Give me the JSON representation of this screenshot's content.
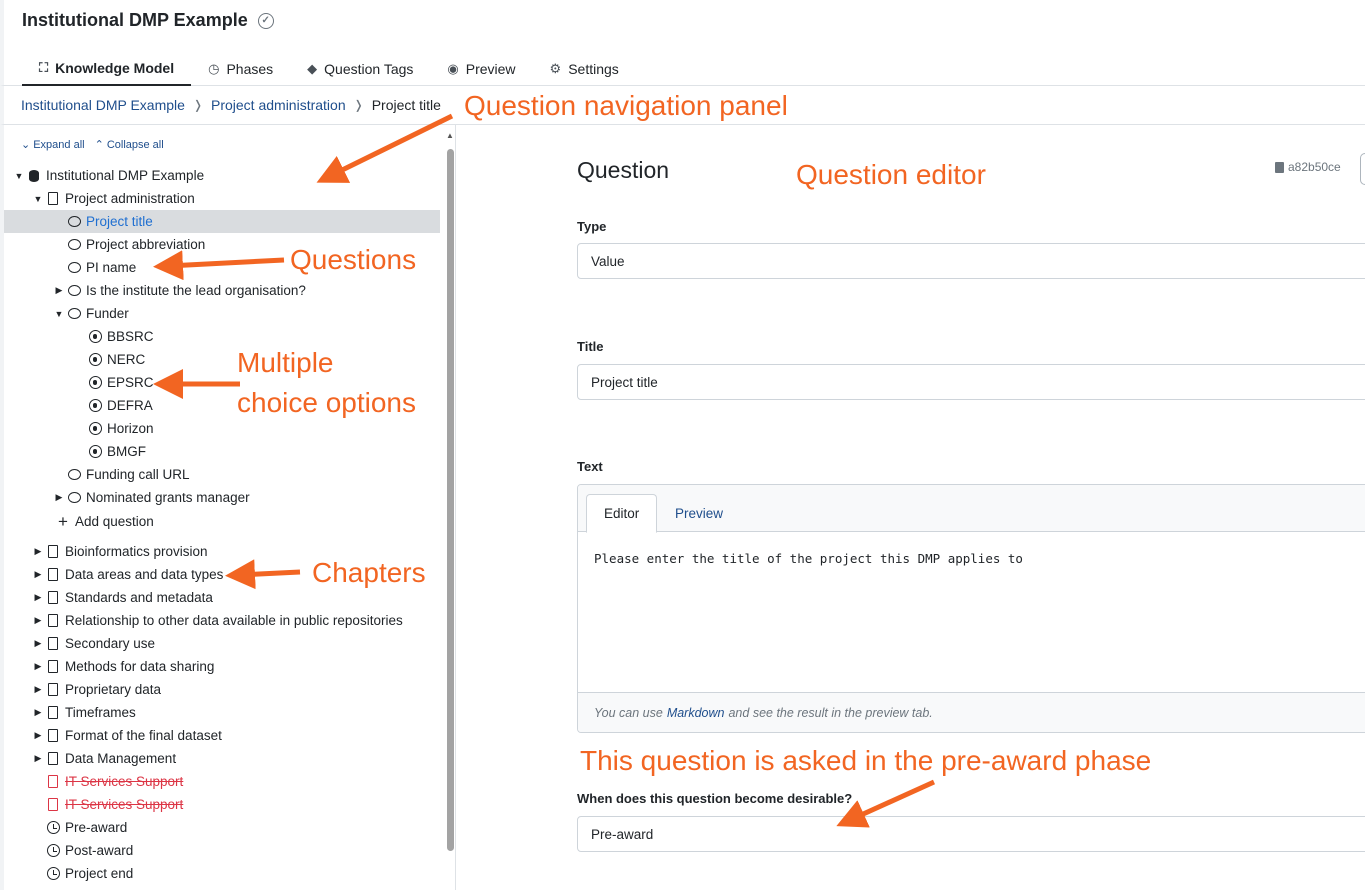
{
  "app": {
    "title": "Institutional DMP Example"
  },
  "tabs": [
    {
      "label": "Knowledge Model",
      "icon": "sitemap-icon"
    },
    {
      "label": "Phases",
      "icon": "clock-icon"
    },
    {
      "label": "Question Tags",
      "icon": "tags-icon"
    },
    {
      "label": "Preview",
      "icon": "eye-icon"
    },
    {
      "label": "Settings",
      "icon": "cogs-icon"
    }
  ],
  "breadcrumb": [
    "Institutional DMP Example",
    "Project administration",
    "Project title"
  ],
  "sidebar": {
    "expand_all": "Expand all",
    "collapse_all": "Collapse all",
    "tree": [
      {
        "label": "Institutional DMP Example",
        "icon": "database-icon",
        "caret": "down",
        "indent": 0
      },
      {
        "label": "Project administration",
        "icon": "file-icon",
        "caret": "down",
        "indent": 1
      },
      {
        "label": "Project title",
        "icon": "comment-icon",
        "indent": 2,
        "selected": true
      },
      {
        "label": "Project abbreviation",
        "icon": "comment-icon",
        "indent": 2
      },
      {
        "label": "PI name",
        "icon": "comment-icon",
        "indent": 2
      },
      {
        "label": "Is the institute the lead organisation?",
        "icon": "comment-icon",
        "caret": "right",
        "indent": 2
      },
      {
        "label": "Funder",
        "icon": "comment-icon",
        "caret": "down",
        "indent": 2
      },
      {
        "label": "BBSRC",
        "icon": "dot-circle-icon",
        "indent": 3
      },
      {
        "label": "NERC",
        "icon": "dot-circle-icon",
        "indent": 3
      },
      {
        "label": "EPSRC",
        "icon": "dot-circle-icon",
        "indent": 3
      },
      {
        "label": "DEFRA",
        "icon": "dot-circle-icon",
        "indent": 3
      },
      {
        "label": "Horizon",
        "icon": "dot-circle-icon",
        "indent": 3
      },
      {
        "label": "BMGF",
        "icon": "dot-circle-icon",
        "indent": 3
      },
      {
        "label": "Funding call URL",
        "icon": "comment-icon",
        "indent": 2
      },
      {
        "label": "Nominated grants manager",
        "icon": "comment-icon",
        "caret": "right",
        "indent": 2
      },
      {
        "label": "Add question",
        "icon": "plus-icon",
        "indent": 2,
        "action": true
      },
      {
        "label": "Bioinformatics provision",
        "icon": "file-icon",
        "caret": "right",
        "indent": 1
      },
      {
        "label": "Data areas and data types",
        "icon": "file-icon",
        "caret": "right",
        "indent": 1
      },
      {
        "label": "Standards and metadata",
        "icon": "file-icon",
        "caret": "right",
        "indent": 1
      },
      {
        "label": "Relationship to other data available in public repositories",
        "icon": "file-icon",
        "caret": "right",
        "indent": 1
      },
      {
        "label": "Secondary use",
        "icon": "file-icon",
        "caret": "right",
        "indent": 1
      },
      {
        "label": "Methods for data sharing",
        "icon": "file-icon",
        "caret": "right",
        "indent": 1
      },
      {
        "label": "Proprietary data",
        "icon": "file-icon",
        "caret": "right",
        "indent": 1
      },
      {
        "label": "Timeframes",
        "icon": "file-icon",
        "caret": "right",
        "indent": 1
      },
      {
        "label": "Format of the final dataset",
        "icon": "file-icon",
        "caret": "right",
        "indent": 1
      },
      {
        "label": "Data Management",
        "icon": "file-icon",
        "caret": "right",
        "indent": 1
      },
      {
        "label": "IT Services Support",
        "icon": "file-icon",
        "indent": 1,
        "deleted": true
      },
      {
        "label": "IT Services Support",
        "icon": "file-icon",
        "indent": 1,
        "deleted": true
      },
      {
        "label": "Pre-award",
        "icon": "clock-icon",
        "indent": 1
      },
      {
        "label": "Post-award",
        "icon": "clock-icon",
        "indent": 1
      },
      {
        "label": "Project end",
        "icon": "clock-icon",
        "indent": 1
      }
    ]
  },
  "editor": {
    "heading": "Question",
    "uuid": "a82b50ce",
    "type_label": "Type",
    "type_value": "Value",
    "title_label": "Title",
    "title_value": "Project title",
    "text_label": "Text",
    "text_tabs": [
      "Editor",
      "Preview"
    ],
    "text_value": "Please enter the title of the project this DMP applies to",
    "hint_prefix": "You can use",
    "hint_link": "Markdown",
    "hint_suffix": "and see the result in the preview tab.",
    "phase_label": "When does this question become desirable?",
    "phase_value": "Pre-award"
  },
  "annotations": {
    "nav_panel": "Question navigation panel",
    "editor": "Question editor",
    "questions": "Questions",
    "multiple_choice": "Multiple\nchoice options",
    "chapters": "Chapters",
    "phase": "This question is asked in the pre-award phase",
    "color": "#f26522"
  }
}
